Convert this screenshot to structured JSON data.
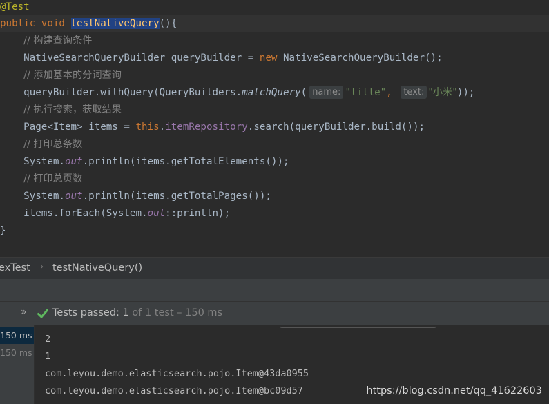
{
  "editor": {
    "annotation": "@Test",
    "method_signature": {
      "modifiers": "public void ",
      "name": "testNativeQuery",
      "rest": "(){"
    },
    "comment1": "// 构建查询条件",
    "line_builder": {
      "left": "    NativeSearchQueryBuilder queryBuilder = ",
      "kw_new": "new",
      "right": " NativeSearchQueryBuilder();"
    },
    "comment2": "// 添加基本的分词查询",
    "line_query": {
      "prefix": "    queryBuilder.withQuery(QueryBuilders.",
      "method": "matchQuery",
      "paren": "(",
      "hint_name": "name:",
      "arg_name": "\"title\"",
      "comma": ",",
      "hint_text": "text:",
      "arg_text": "\"小米\"",
      "suffix": "));"
    },
    "comment3": "// 执行搜索，获取结果",
    "line_search": {
      "left": "    Page<Item> items = ",
      "kw_this": "this",
      "dot": ".",
      "field": "itemRepository",
      "right": ".search(queryBuilder.build());"
    },
    "comment4": "// 打印总条数",
    "line_total_elements": {
      "left": "    System.",
      "field": "out",
      "right": ".println(items.getTotalElements());"
    },
    "comment5": "// 打印总页数",
    "line_total_pages": {
      "left": "    System.",
      "field": "out",
      "right": ".println(items.getTotalPages());"
    },
    "line_foreach": {
      "left": "    items.forEach(System.",
      "field": "out",
      "right": "::println);"
    },
    "closing_brace": "}"
  },
  "breadcrumb": {
    "class_name": "exTest",
    "method_name": "testNativeQuery()"
  },
  "run_panel": {
    "status_label": "Tests passed: ",
    "status_count": "1",
    "status_detail": " of 1 test – 150 ms",
    "tree": [
      {
        "label": "150 ms",
        "selected": true
      },
      {
        "label": "150 ms",
        "selected": false
      }
    ],
    "console_lines": [
      "2",
      "1",
      "com.leyou.demo.elasticsearch.pojo.Item@43da0955",
      "com.leyou.demo.elasticsearch.pojo.Item@bc09d57"
    ]
  },
  "watermark": "https://blog.csdn.net/qq_41622603",
  "colors": {
    "editor_bg": "#2b2b2b",
    "keyword": "#cc7832",
    "string": "#6a8759",
    "comment": "#808080",
    "field": "#9876aa",
    "method_decl": "#ffc66d",
    "annotation": "#bbb529",
    "pass_green": "#5fb85f"
  }
}
